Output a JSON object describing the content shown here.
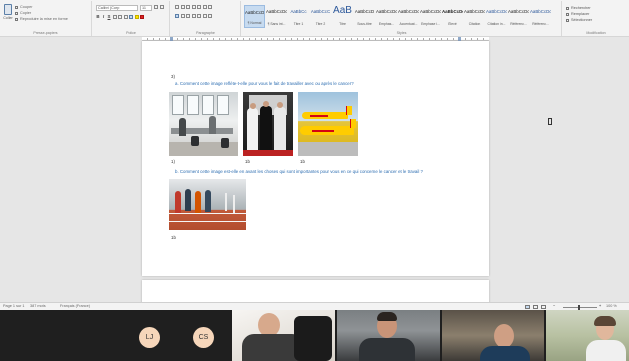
{
  "ribbon": {
    "clipboard": {
      "paste_label": "Coller",
      "items": [
        "Couper",
        "Copier",
        "Reproduire la mise en forme"
      ],
      "group_label": "Presse-papiers"
    },
    "font": {
      "name": "Calibri (Corp",
      "size": "11",
      "group_label": "Police"
    },
    "paragraph": {
      "group_label": "Paragraphe"
    },
    "styles": {
      "items": [
        {
          "sample": "AaBbCcDc",
          "name": "¶ Normal"
        },
        {
          "sample": "AaBbCcDc",
          "name": "¶ Sans int..."
        },
        {
          "sample": "AaBbCc",
          "name": "Titre 1"
        },
        {
          "sample": "AaBbCcC",
          "name": "Titre 2"
        },
        {
          "sample": "AaB",
          "name": "Titre"
        },
        {
          "sample": "AaBbCcD",
          "name": "Sous-titre"
        },
        {
          "sample": "AaBbCcDc",
          "name": "Emphas..."
        },
        {
          "sample": "AaBbCcDc",
          "name": "Accentuat..."
        },
        {
          "sample": "AaBbCcDc",
          "name": "Emphase i..."
        },
        {
          "sample": "AaBbCcDc",
          "name": "Élevé"
        },
        {
          "sample": "AaBbCcDc",
          "name": "Citation"
        },
        {
          "sample": "AaBbCcDc",
          "name": "Citation in..."
        },
        {
          "sample": "AaBbCcDc",
          "name": "Référenc..."
        },
        {
          "sample": "AaBbCcDc",
          "name": "Référenc..."
        }
      ],
      "group_label": "Styles"
    },
    "editing": {
      "items": [
        "Rechercher",
        "Remplacer",
        "Sélectionner"
      ],
      "group_label": "Modification"
    }
  },
  "document": {
    "question_number": "3)",
    "q1": "a.   Comment cette image reflète-t-elle pour vous le fait de travailler avec ou après le cancer?",
    "labels": [
      "1)",
      "1b",
      "1b"
    ],
    "q2": "b.   Comment cette image est-elle en avant les choses qui sont importantes pour vous en ce qui concerne le cancer et le travail ?",
    "label_4": "1b"
  },
  "statusbar": {
    "page": "Page 1 sur 1",
    "words": "387 mots",
    "language": "Français (France)",
    "zoom": "100 %"
  },
  "participants": [
    {
      "initials": "LJ",
      "color": "#f6d6ba"
    },
    {
      "initials": "CS",
      "color": "#f6d6ba"
    }
  ]
}
